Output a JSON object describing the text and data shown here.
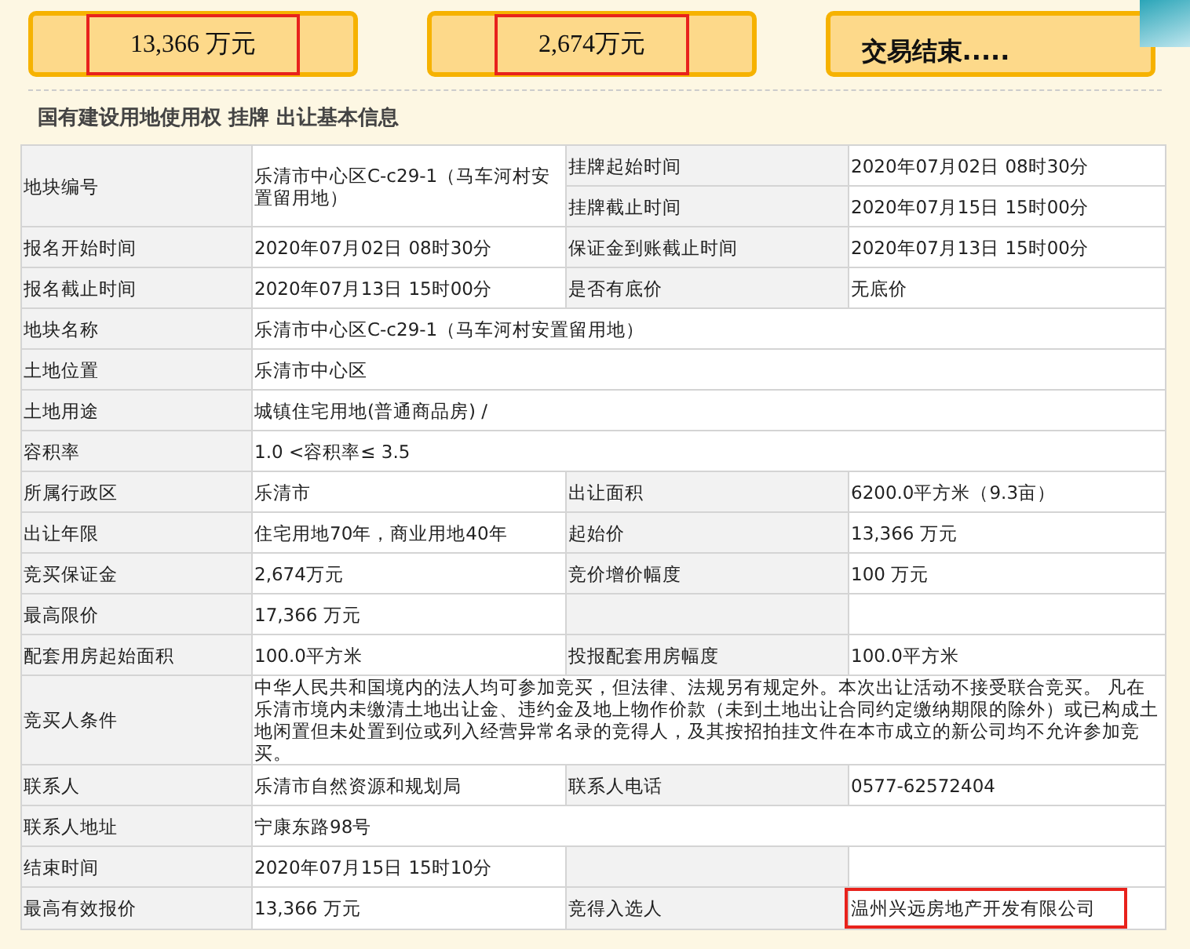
{
  "price_cards": [
    {
      "text": "13,366 万元",
      "highlighted": true,
      "bold": false
    },
    {
      "text": "2,674万元",
      "highlighted": true,
      "bold": false
    },
    {
      "text": "交易结束.....",
      "highlighted": false,
      "bold": true
    }
  ],
  "section_title": "国有建设用地使用权  挂牌 出让基本信息",
  "table": {
    "rows": [
      [
        {
          "kind": "label",
          "text": "地块编号",
          "rowspan": 2
        },
        {
          "kind": "value",
          "text": "乐清市中心区C-c29-1（马车河村安置留用地）",
          "rowspan": 2
        },
        {
          "kind": "label",
          "text": "挂牌起始时间"
        },
        {
          "kind": "value",
          "text": "2020年07月02日 08时30分"
        }
      ],
      [
        {
          "kind": "label",
          "text": "挂牌截止时间"
        },
        {
          "kind": "value",
          "text": "2020年07月15日 15时00分"
        }
      ],
      [
        {
          "kind": "label",
          "text": "报名开始时间"
        },
        {
          "kind": "value",
          "text": "2020年07月02日 08时30分"
        },
        {
          "kind": "label",
          "text": "保证金到账截止时间"
        },
        {
          "kind": "value",
          "text": "2020年07月13日 15时00分"
        }
      ],
      [
        {
          "kind": "label",
          "text": "报名截止时间"
        },
        {
          "kind": "value",
          "text": "2020年07月13日 15时00分"
        },
        {
          "kind": "label",
          "text": "是否有底价"
        },
        {
          "kind": "value",
          "text": "无底价"
        }
      ],
      [
        {
          "kind": "label",
          "text": "地块名称"
        },
        {
          "kind": "value",
          "text": "乐清市中心区C-c29-1（马车河村安置留用地）",
          "colspan": 3
        }
      ],
      [
        {
          "kind": "label",
          "text": "土地位置"
        },
        {
          "kind": "value",
          "text": "乐清市中心区",
          "colspan": 3
        }
      ],
      [
        {
          "kind": "label",
          "text": "土地用途"
        },
        {
          "kind": "value",
          "text": "城镇住宅用地(普通商品房) /",
          "colspan": 3
        }
      ],
      [
        {
          "kind": "label",
          "text": "容积率"
        },
        {
          "kind": "value",
          "text": "1.0 <容积率≤ 3.5",
          "colspan": 3
        }
      ],
      [
        {
          "kind": "label",
          "text": "所属行政区"
        },
        {
          "kind": "value",
          "text": "乐清市"
        },
        {
          "kind": "label",
          "text": "出让面积"
        },
        {
          "kind": "value",
          "text": "6200.0平方米（9.3亩）"
        }
      ],
      [
        {
          "kind": "label",
          "text": "出让年限"
        },
        {
          "kind": "value",
          "text": "住宅用地70年，商业用地40年"
        },
        {
          "kind": "label",
          "text": "起始价"
        },
        {
          "kind": "value",
          "text": "13,366 万元"
        }
      ],
      [
        {
          "kind": "label",
          "text": "竞买保证金"
        },
        {
          "kind": "value",
          "text": "2,674万元"
        },
        {
          "kind": "label",
          "text": "竞价增价幅度"
        },
        {
          "kind": "value",
          "text": "100 万元"
        }
      ],
      [
        {
          "kind": "label",
          "text": "最高限价"
        },
        {
          "kind": "value",
          "text": "17,366 万元"
        },
        {
          "kind": "label"
        },
        {
          "kind": "value"
        }
      ],
      [
        {
          "kind": "label",
          "text": "配套用房起始面积"
        },
        {
          "kind": "value",
          "text": "100.0平方米"
        },
        {
          "kind": "label",
          "text": "投报配套用房幅度"
        },
        {
          "kind": "value",
          "text": "100.0平方米"
        }
      ],
      [
        {
          "kind": "label",
          "text": "竞买人条件"
        },
        {
          "kind": "value",
          "text": "中华人民共和国境内的法人均可参加竞买，但法律、法规另有规定外。本次出让活动不接受联合竞买。 凡在乐清市境内未缴清土地出让金、违约金及地上物作价款（未到土地出让合同约定缴纳期限的除外）或已构成土地闲置但未处置到位或列入经营异常名录的竞得人，及其按招拍挂文件在本市成立的新公司均不允许参加竞买。",
          "colspan": 3
        }
      ],
      [
        {
          "kind": "label",
          "text": "联系人"
        },
        {
          "kind": "value",
          "text": "乐清市自然资源和规划局"
        },
        {
          "kind": "label",
          "text": "联系人电话"
        },
        {
          "kind": "value",
          "text": "0577-62572404"
        }
      ],
      [
        {
          "kind": "label",
          "text": "联系人地址"
        },
        {
          "kind": "value",
          "text": "宁康东路98号",
          "colspan": 3
        }
      ],
      [
        {
          "kind": "label",
          "text": "结束时间"
        },
        {
          "kind": "value",
          "text": "2020年07月15日 15时10分"
        },
        {
          "kind": "label"
        },
        {
          "kind": "value"
        }
      ],
      [
        {
          "kind": "label",
          "text": "最高有效报价"
        },
        {
          "kind": "value",
          "text": "13,366 万元"
        },
        {
          "kind": "label",
          "text": "竞得入选人"
        },
        {
          "kind": "value",
          "text": "温州兴远房地产开发有限公司",
          "highlighted": true
        }
      ]
    ]
  }
}
